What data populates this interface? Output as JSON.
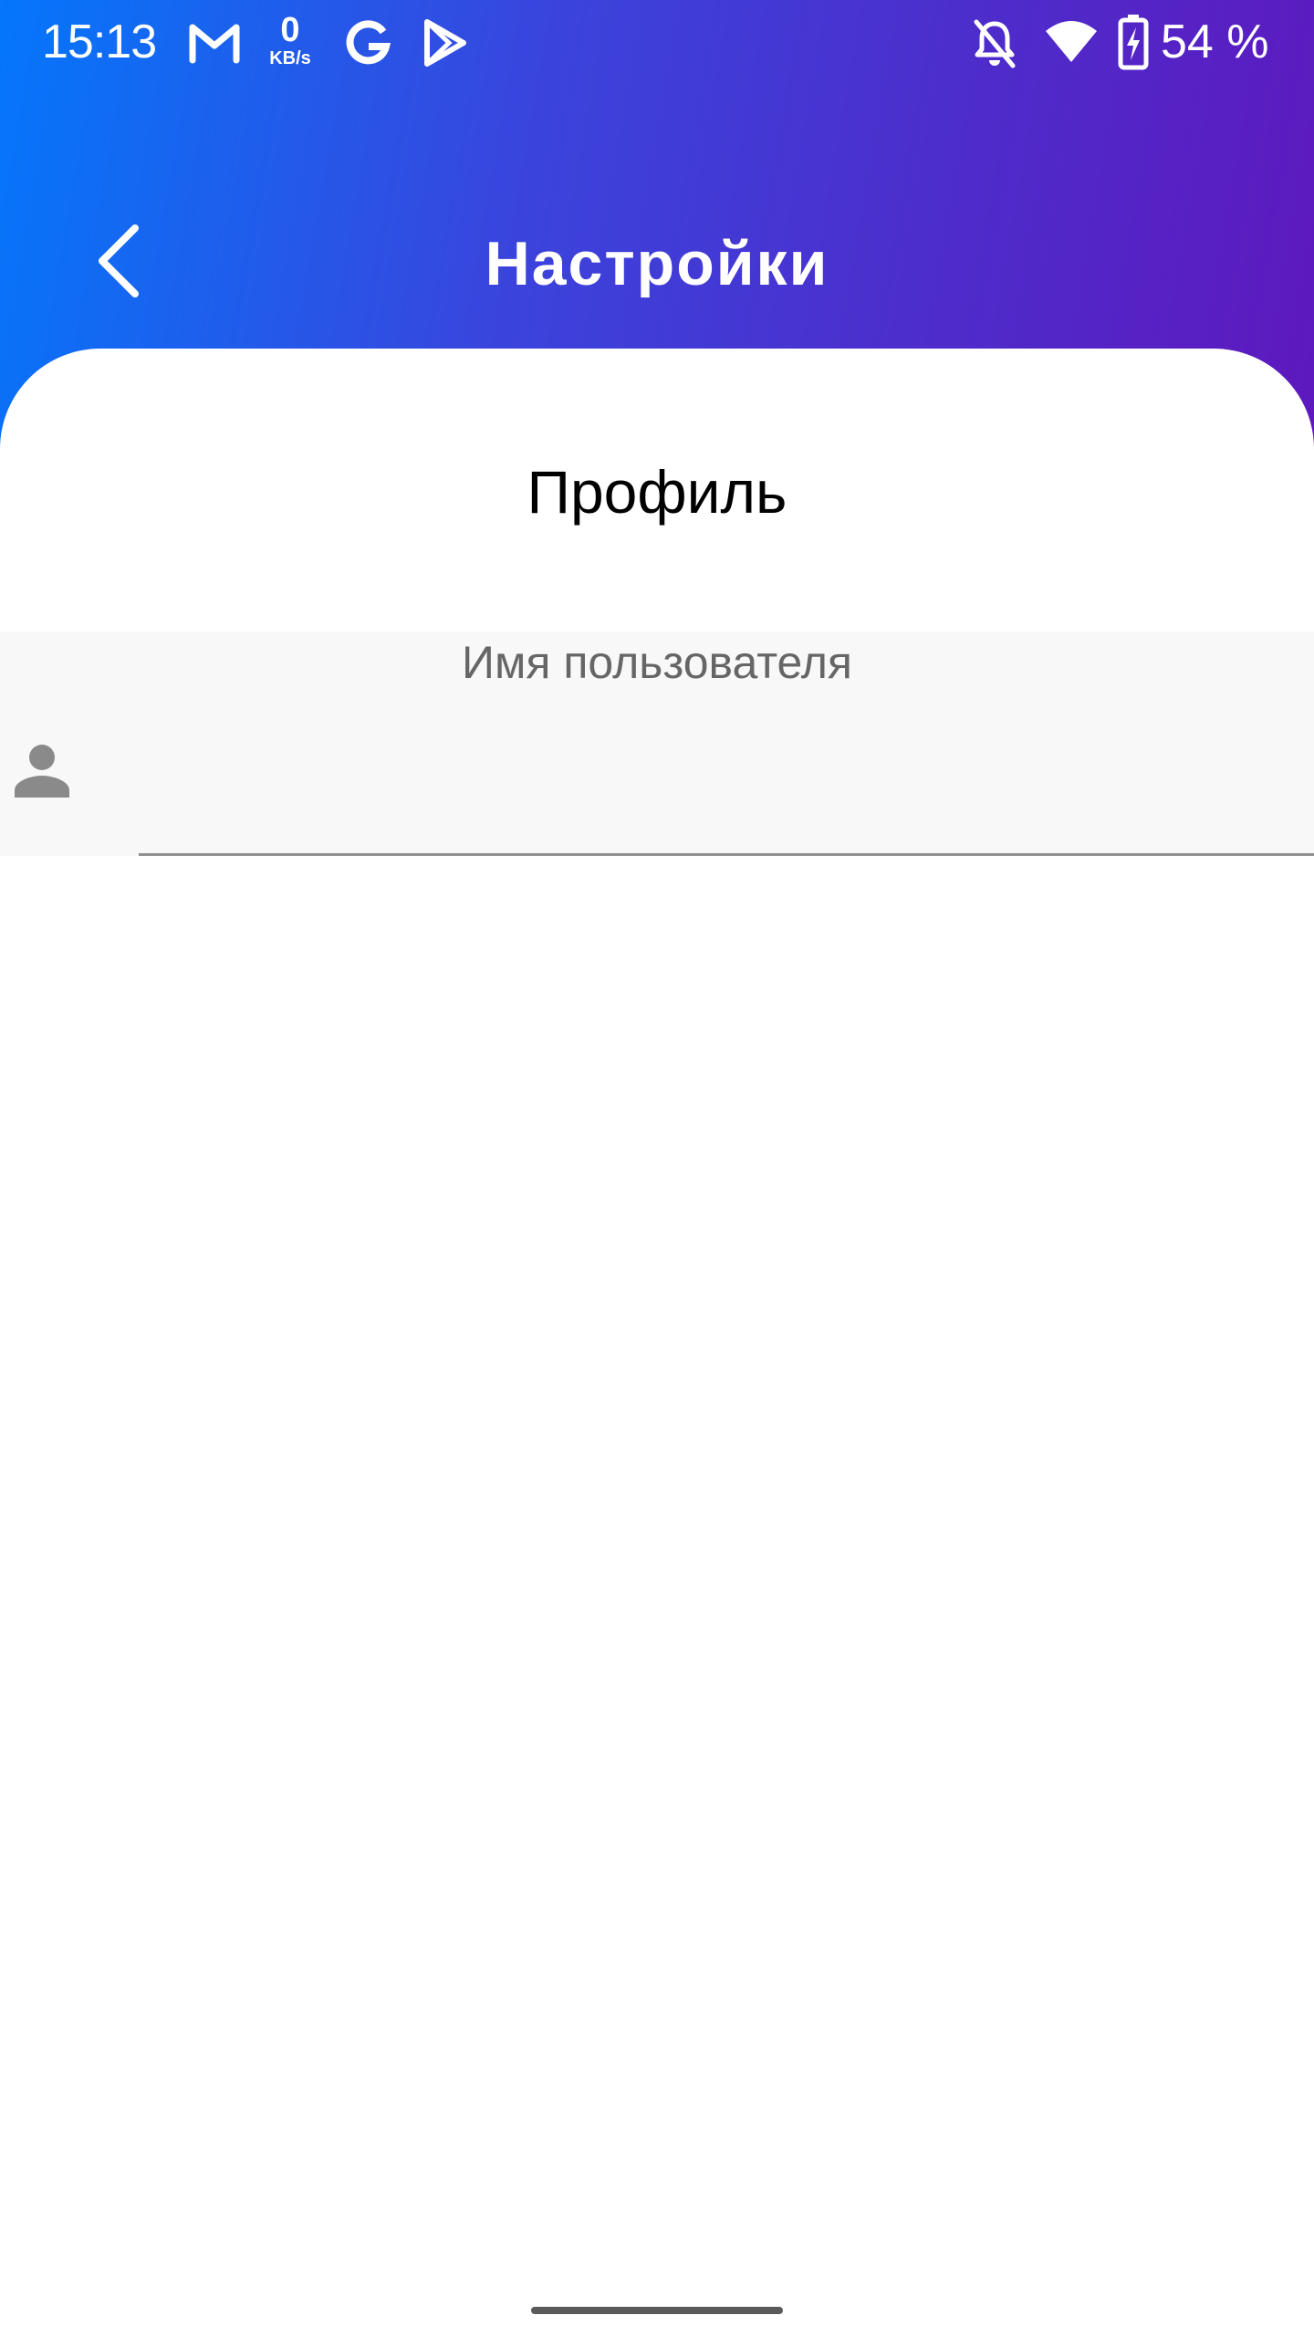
{
  "status_bar": {
    "time": "15:13",
    "network_speed_value": "0",
    "network_speed_unit": "KB/s",
    "battery_percent": "54 %",
    "icons": [
      "gmail-icon",
      "google-icon",
      "play-store-icon",
      "notifications-off-icon",
      "wifi-icon",
      "battery-charging-icon"
    ]
  },
  "app_bar": {
    "title": "Настройки",
    "back_icon": "chevron-left-icon"
  },
  "profile": {
    "section_title": "Профиль",
    "username_field": {
      "label": "Имя пользователя",
      "value": "",
      "icon": "person-icon"
    }
  },
  "colors": {
    "gradient_start": "#0477fb",
    "gradient_end": "#5e18bd",
    "field_background": "#f8f8f8",
    "label_gray": "#666666",
    "icon_gray": "#8a8a8a"
  }
}
